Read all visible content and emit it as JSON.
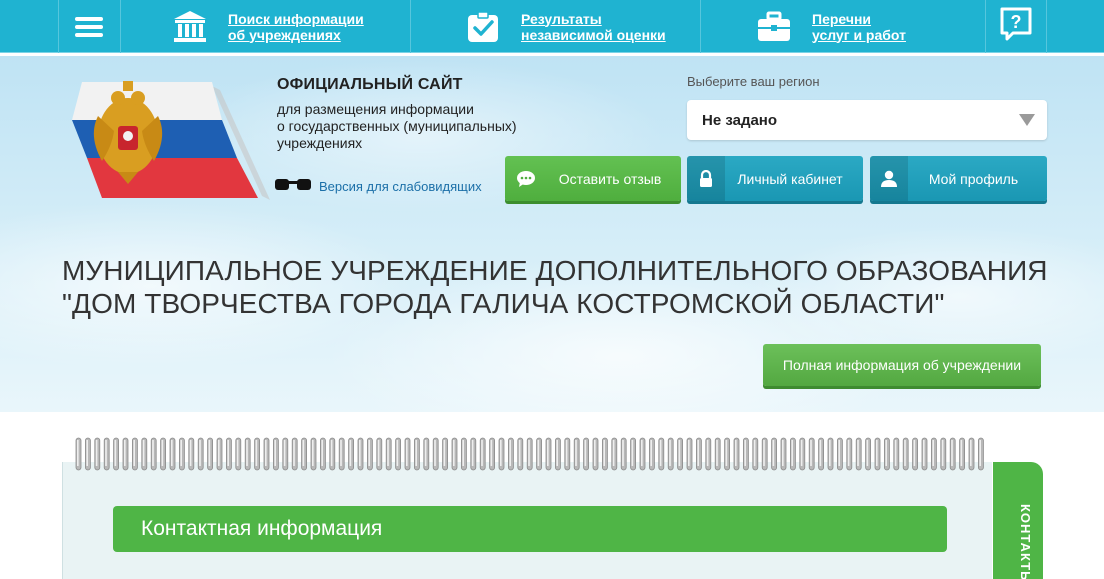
{
  "nav": {
    "items": [
      {
        "line1": "Поиск информации",
        "line2": "об учреждениях",
        "icon": "institution-icon"
      },
      {
        "line1": "Результаты",
        "line2": "независимой оценки",
        "icon": "checkmark-clipboard-icon"
      },
      {
        "line1": "Перечни",
        "line2": "услуг и работ",
        "icon": "briefcase-icon"
      }
    ],
    "menu_icon": "hamburger-menu-icon",
    "help_icon": "question-bubble-icon"
  },
  "header": {
    "title": "ОФИЦИАЛЬНЫЙ САЙТ",
    "subtitle_lines": [
      "для размещения информации",
      "о государственных (муниципальных)",
      "учреждениях"
    ],
    "vision_link": "Версия для слабовидящих"
  },
  "region": {
    "label": "Выберите ваш регион",
    "value": "Не задано"
  },
  "buttons": {
    "feedback": "Оставить отзыв",
    "cabinet": "Личный кабинет",
    "profile": "Мой профиль",
    "full_info": "Полная информация об учреждении"
  },
  "organization": {
    "name_lines": [
      "МУНИЦИПАЛЬНОЕ УЧРЕЖДЕНИЕ ДОПОЛНИТЕЛЬНОГО ОБРАЗОВАНИЯ",
      "\"ДОМ ТВОРЧЕСТВА ГОРОДА ГАЛИЧА КОСТРОМСКОЙ ОБЛАСТИ\""
    ]
  },
  "notebook": {
    "section_title": "Контактная информация",
    "side_tab": "КОНТАКТЫ"
  },
  "colors": {
    "nav_bg": "#1fb3d1",
    "green": "#4fb546",
    "teal_button": "#1a97b3"
  }
}
